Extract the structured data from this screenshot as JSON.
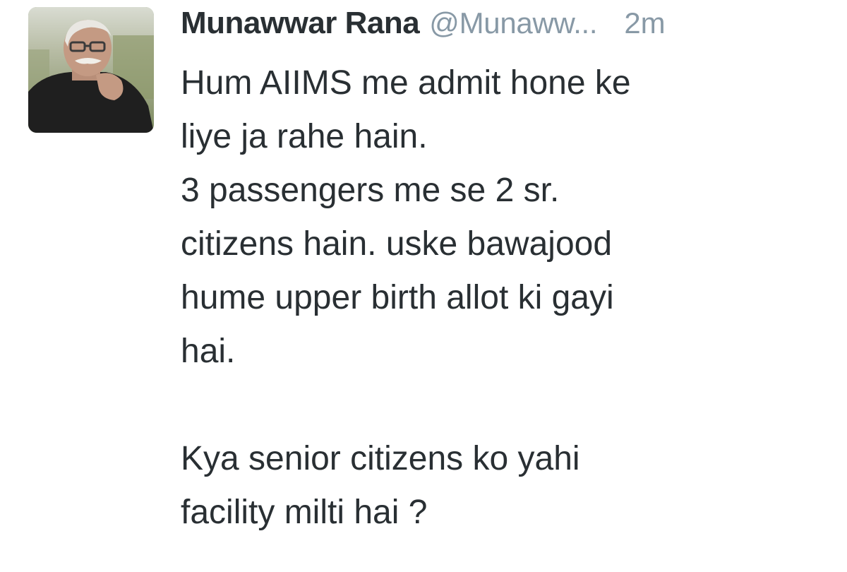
{
  "tweet": {
    "author": {
      "name": "Munawwar Rana",
      "handle": "@Munaww...",
      "avatar_icon": "profile-photo"
    },
    "timestamp": "2m",
    "text_lines": [
      "Hum AIIMS me admit hone ke",
      "liye ja rahe hain.",
      "3 passengers me se 2 sr.",
      "citizens hain. uske bawajood",
      "hume upper birth allot ki gayi",
      "hai.",
      "",
      "Kya senior citizens ko yahi",
      "facility milti hai ?"
    ]
  },
  "colors": {
    "text": "#292f33",
    "secondary_text": "#8899a6",
    "background": "#ffffff"
  }
}
